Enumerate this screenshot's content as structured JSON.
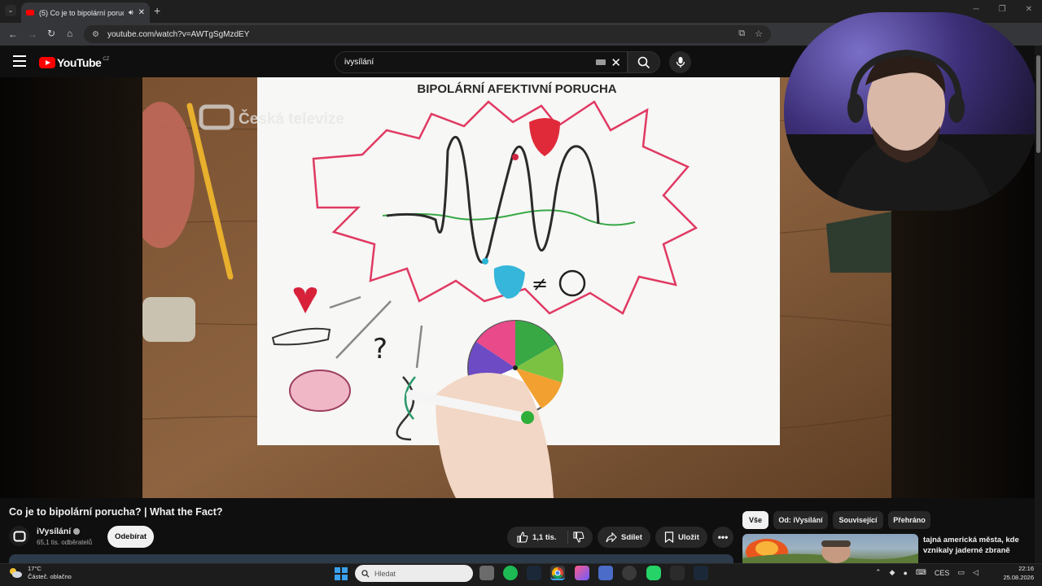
{
  "browser": {
    "tab_title": "(5) Co je to bipolární poruc",
    "address": "youtube.com/watch?v=AWTgSgMzdEY"
  },
  "youtube": {
    "logo_text": "YouTube",
    "region": "CZ",
    "search_query": "ivysílání"
  },
  "video": {
    "watermark": "Česká televize",
    "board_heading": "BIPOLÁRNÍ AFEKTIVNÍ PORUCHA",
    "title": "Co je to bipolární porucha? | What the Fact?"
  },
  "channel": {
    "name": "iVysílání",
    "subscribers": "65,1 tis. odběratelů",
    "subscribe_label": "Odebírat"
  },
  "actions": {
    "likes": "1,1 tis.",
    "share": "Sdílet",
    "save": "Uložit"
  },
  "chips": [
    "Vše",
    "Od: iVysílání",
    "Související",
    "Přehráno"
  ],
  "recommendation": {
    "title": "tajná americká města, kde vznikaly jaderné zbraně"
  },
  "taskbar": {
    "temperature": "17°C",
    "weather": "Částeč. oblačno",
    "search_placeholder": "Hledat",
    "language": "CES",
    "time": "22:16",
    "date": "25.08.2026"
  },
  "colors": {
    "youtube_red": "#ff0000",
    "background": "#0f0f0f",
    "accent_blue": "#3aa0f0"
  }
}
